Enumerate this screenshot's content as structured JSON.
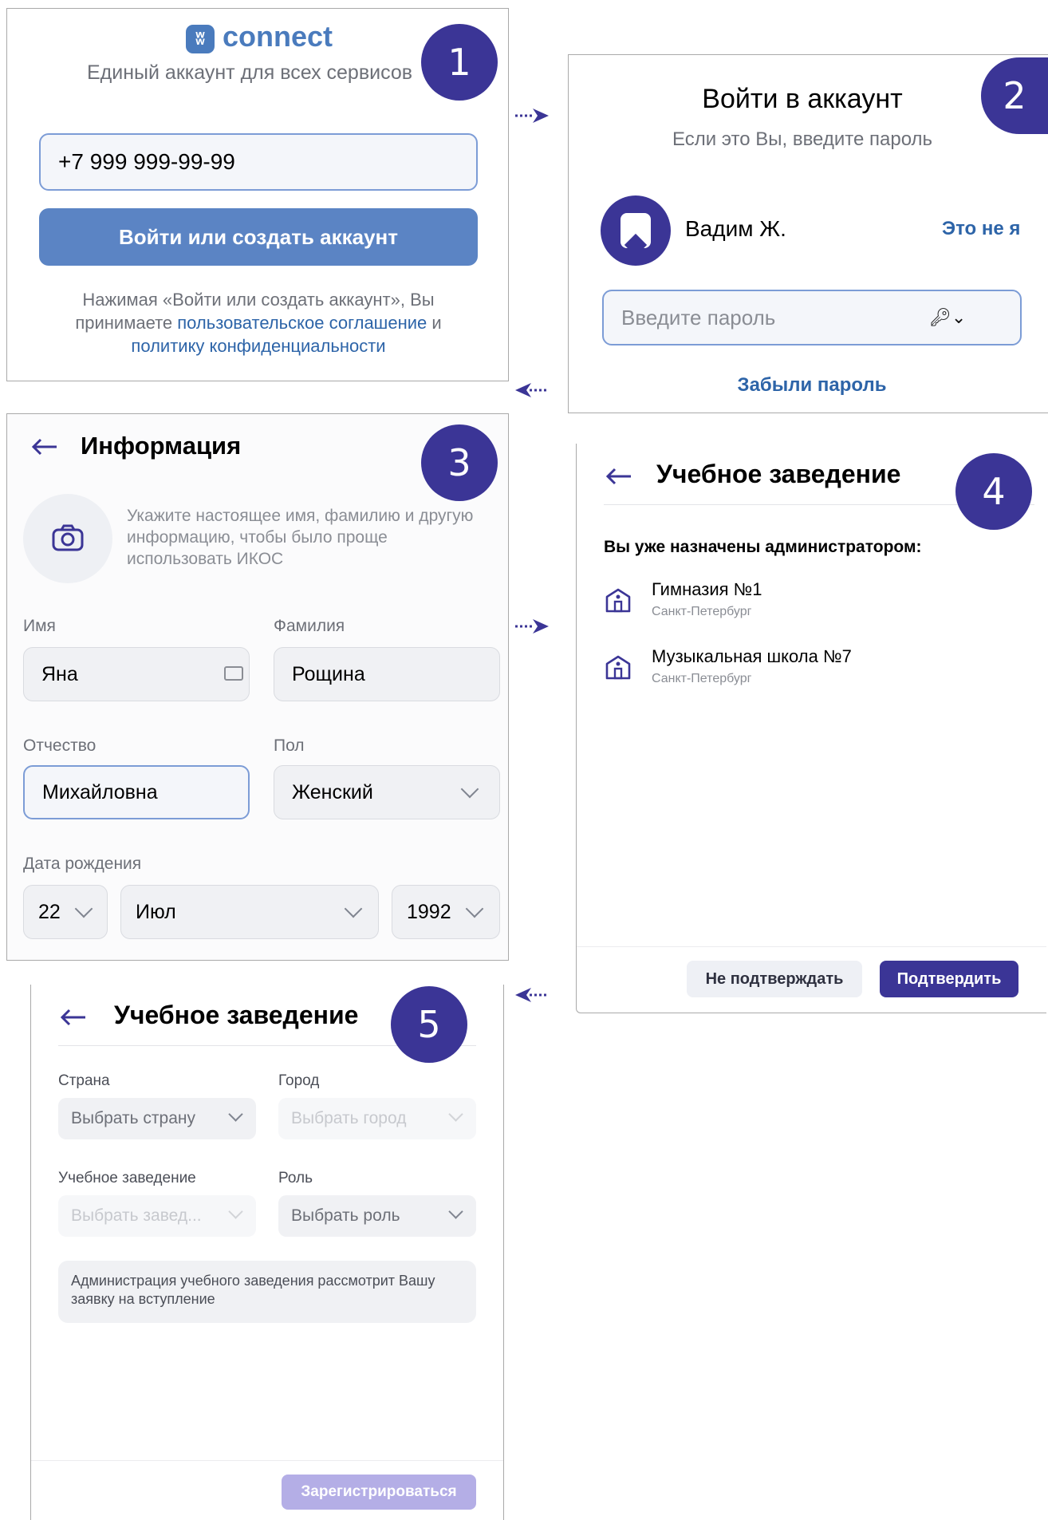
{
  "colors": {
    "badge": "#3b3596",
    "vk_blue": "#4a7bbd",
    "primary": "#3b3596",
    "link": "#2d64a8"
  },
  "badges": [
    "1",
    "2",
    "3",
    "4",
    "5"
  ],
  "p1": {
    "logo_text": "connect",
    "subtitle": "Единый аккаунт для всех сервисов",
    "phone_value": "+7 999 999-99-99",
    "login_button": "Войти или создать аккаунт",
    "terms_prefix": "Нажимая «Войти или создать аккаунт», Вы принимаете ",
    "terms_link1": "пользовательское соглашение",
    "terms_and": " и ",
    "terms_link2": "политику конфиденциальности"
  },
  "p2": {
    "title": "Войти в аккаунт",
    "subtitle": "Если это Вы, введите пароль",
    "user_name": "Вадим Ж.",
    "not_me": "Это не я",
    "password_placeholder": "Введите пароль",
    "forgot": "Забыли пароль"
  },
  "p3": {
    "title": "Информация",
    "hint": "Укажите настоящее имя, фамилию и другую информацию, чтобы было проще использовать ИКОС",
    "first_name_label": "Имя",
    "first_name_value": "Яна",
    "last_name_label": "Фамилия",
    "last_name_value": "Рощина",
    "patronymic_label": "Отчество",
    "patronymic_value": "Михайловна",
    "gender_label": "Пол",
    "gender_value": "Женский",
    "dob_label": "Дата рождения",
    "dob_day": "22",
    "dob_month": "Июл",
    "dob_year": "1992"
  },
  "p4": {
    "title": "Учебное заведение",
    "assigned_label": "Вы уже назначены администратором:",
    "schools": [
      {
        "name": "Гимназия №1",
        "city": "Санкт-Петербург"
      },
      {
        "name": "Музыкальная школа №7",
        "city": "Санкт-Петербург"
      }
    ],
    "decline_button": "Не подтверждать",
    "confirm_button": "Подтвердить"
  },
  "p5": {
    "title": "Учебное заведение",
    "country_label": "Страна",
    "country_placeholder": "Выбрать страну",
    "city_label": "Город",
    "city_placeholder": "Выбрать город",
    "school_label": "Учебное заведение",
    "school_placeholder": "Выбрать завед...",
    "role_label": "Роль",
    "role_placeholder": "Выбрать роль",
    "notice": "Администрация учебного заведения рассмотрит Вашу заявку на вступление",
    "register_button": "Зарегистрироваться"
  }
}
